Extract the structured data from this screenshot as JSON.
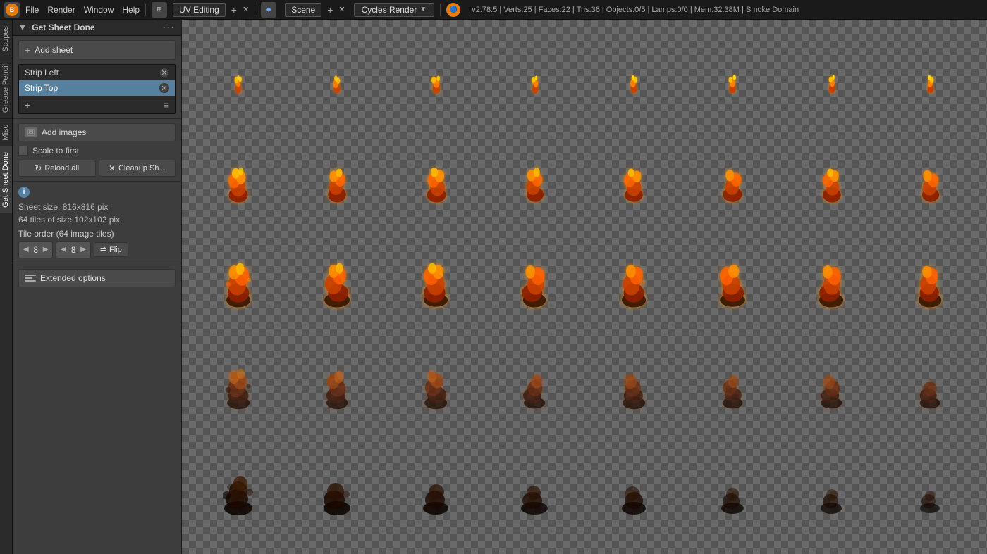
{
  "topbar": {
    "blender_version": "v2.78.5 | Verts:25 | Faces:22 | Tris:36 | Objects:0/5 | Lamps:0/0 | Mem:32.38M | Smoke Domain",
    "workspace": "UV Editing",
    "scene": "Scene",
    "render_engine": "Cycles Render",
    "menu_items": [
      "File",
      "Render",
      "Window",
      "Help"
    ]
  },
  "vtabs": [
    {
      "label": "Scopes",
      "active": false
    },
    {
      "label": "Grease Pencil",
      "active": false
    },
    {
      "label": "Misc",
      "active": false
    },
    {
      "label": "Get Sheet Done",
      "active": true
    }
  ],
  "panel": {
    "title": "Get Sheet Done",
    "add_sheet_label": "Add sheet",
    "strips": [
      {
        "name": "Strip Left",
        "selected": false
      },
      {
        "name": "Strip Top",
        "selected": true
      }
    ],
    "add_images_label": "Add images",
    "scale_to_first_label": "Scale to first",
    "reload_all_label": "Reload all",
    "cleanup_label": "Cleanup Sh...",
    "info_icon": "i",
    "sheet_size": "Sheet size: 816x816 pix",
    "tile_count": "64 tiles of size 102x102 pix",
    "tile_order_label": "Tile order (64 image tiles)",
    "tile_cols": "8",
    "tile_rows": "8",
    "flip_label": "Flip",
    "extended_options_label": "Extended options"
  }
}
